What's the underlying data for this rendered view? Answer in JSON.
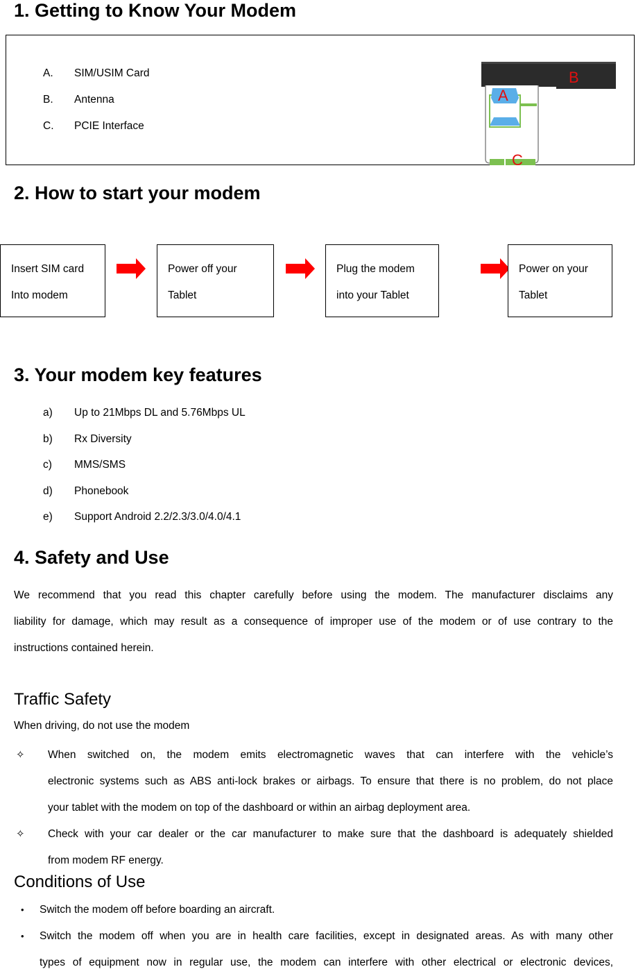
{
  "section1": {
    "title": "1.  Getting to Know Your Modem",
    "parts": [
      {
        "marker": "A.",
        "label": "SIM/USIM Card"
      },
      {
        "marker": "B.",
        "label": "Antenna"
      },
      {
        "marker": "C.",
        "label": "PCIE Interface"
      }
    ],
    "image": {
      "labels": {
        "a": "A",
        "b": "B",
        "c": "C"
      },
      "colors": {
        "body": "#2b2b2b",
        "sim": "#5aaee8",
        "pcie": "#7cc050",
        "label": "#e01010"
      }
    }
  },
  "section2": {
    "title": "2. How to start your modem",
    "steps": [
      {
        "line1": "Insert SIM card",
        "line2": "Into modem"
      },
      {
        "line1": "Power off your",
        "line2": "Tablet"
      },
      {
        "line1": "Plug the modem",
        "line2": "into your Tablet"
      },
      {
        "line1": "Power on your",
        "line2": "Tablet"
      }
    ],
    "arrow_color": "#ff0000"
  },
  "section3": {
    "title": "3.  Your modem key features",
    "features": [
      {
        "marker": "a)",
        "label": "Up to 21Mbps DL and 5.76Mbps UL"
      },
      {
        "marker": "b)",
        "label": "Rx Diversity"
      },
      {
        "marker": "c)",
        "label": "MMS/SMS"
      },
      {
        "marker": "d)",
        "label": "Phonebook"
      },
      {
        "marker": "e)",
        "label": "Support Android 2.2/2.3/3.0/4.0/4.1"
      }
    ]
  },
  "section4": {
    "title": "4. Safety and Use",
    "intro_lines": [
      "We recommend that you read this chapter carefully before using the modem. The manufacturer disclaims any",
      "liability for damage, which may result as a consequence of improper use of the modem or of use contrary to the",
      "instructions contained herein."
    ],
    "traffic": {
      "title": "Traffic Safety",
      "lead": "When driving, do not use the modem",
      "marker": "✧",
      "items": [
        {
          "lines": [
            "When switched on, the modem emits electromagnetic waves that can interfere with the vehicle’s",
            "electronic systems such as ABS anti-lock brakes or airbags. To ensure that there is no problem, do not place",
            "your tablet with the modem on top of the dashboard or within an airbag deployment area."
          ]
        },
        {
          "lines": [
            "Check with your car dealer or the car manufacturer to make sure that the dashboard is adequately shielded",
            "from modem RF energy."
          ]
        }
      ]
    },
    "conditions": {
      "title": "Conditions of Use",
      "marker": "•",
      "items": [
        {
          "lines": [
            "Switch the modem off before boarding an aircraft."
          ]
        },
        {
          "lines": [
            "Switch the modem off when you are in health care facilities, except in designated areas. As with many other",
            "types of equipment now in regular use, the modem can interfere with other electrical or electronic devices,"
          ]
        }
      ]
    }
  }
}
